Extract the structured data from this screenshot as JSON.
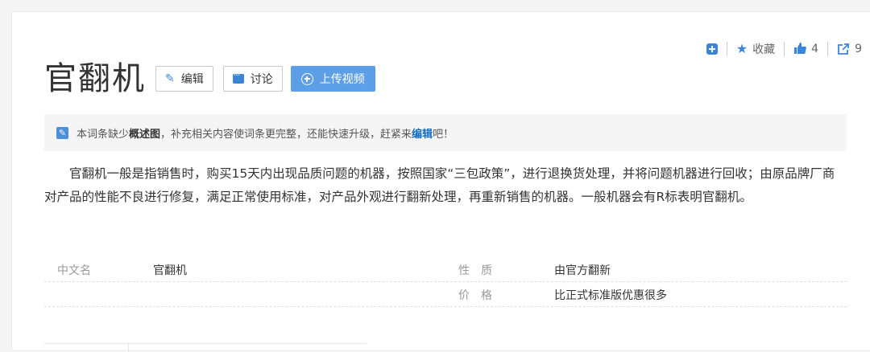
{
  "toolbar": {
    "collect_label": "收藏",
    "like_count": "4",
    "share_count": "9"
  },
  "header": {
    "title": "官翻机",
    "edit_label": "编辑",
    "discuss_label": "讨论",
    "upload_label": "上传视频"
  },
  "notice": {
    "prefix": "本词条缺少",
    "bold": "概述图",
    "middle": "，补充相关内容使词条更完整，还能快速升级，赶紧来",
    "link": "编辑",
    "suffix": "吧！"
  },
  "summary": "官翻机一般是指销售时，购买15天内出现品质问题的机器，按照国家“三包政策”，进行退换货处理，并将问题机器进行回收；由原品牌厂商对产品的性能不良进行修复，满足正常使用标准，对产品外观进行翻新处理，再重新销售的机器。一般机器会有R标表明官翻机。",
  "basic_info": {
    "left": [
      {
        "name": "中文名",
        "value": "官翻机"
      }
    ],
    "right": [
      {
        "name": "性质",
        "value": "由官方翻新"
      },
      {
        "name": "价格",
        "value": "比正式标准版优惠很多"
      }
    ]
  },
  "colors": {
    "accent": "#3b85d8",
    "primary_button": "#5d9fe6",
    "link": "#136ec2"
  }
}
